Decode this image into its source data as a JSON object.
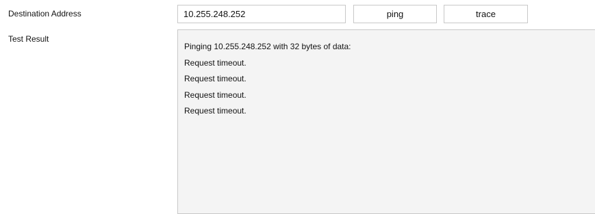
{
  "form": {
    "destination_label": "Destination Address",
    "destination_value": "10.255.248.252",
    "ping_label": "ping",
    "trace_label": "trace",
    "result_label": "Test Result"
  },
  "result": {
    "lines": [
      "Pinging 10.255.248.252 with 32 bytes of data:",
      "Request timeout.",
      "Request timeout.",
      "Request timeout.",
      "Request timeout."
    ]
  },
  "colors": {
    "border": "#c8c8c8",
    "result_background": "#f4f4f4",
    "text": "#111111"
  }
}
